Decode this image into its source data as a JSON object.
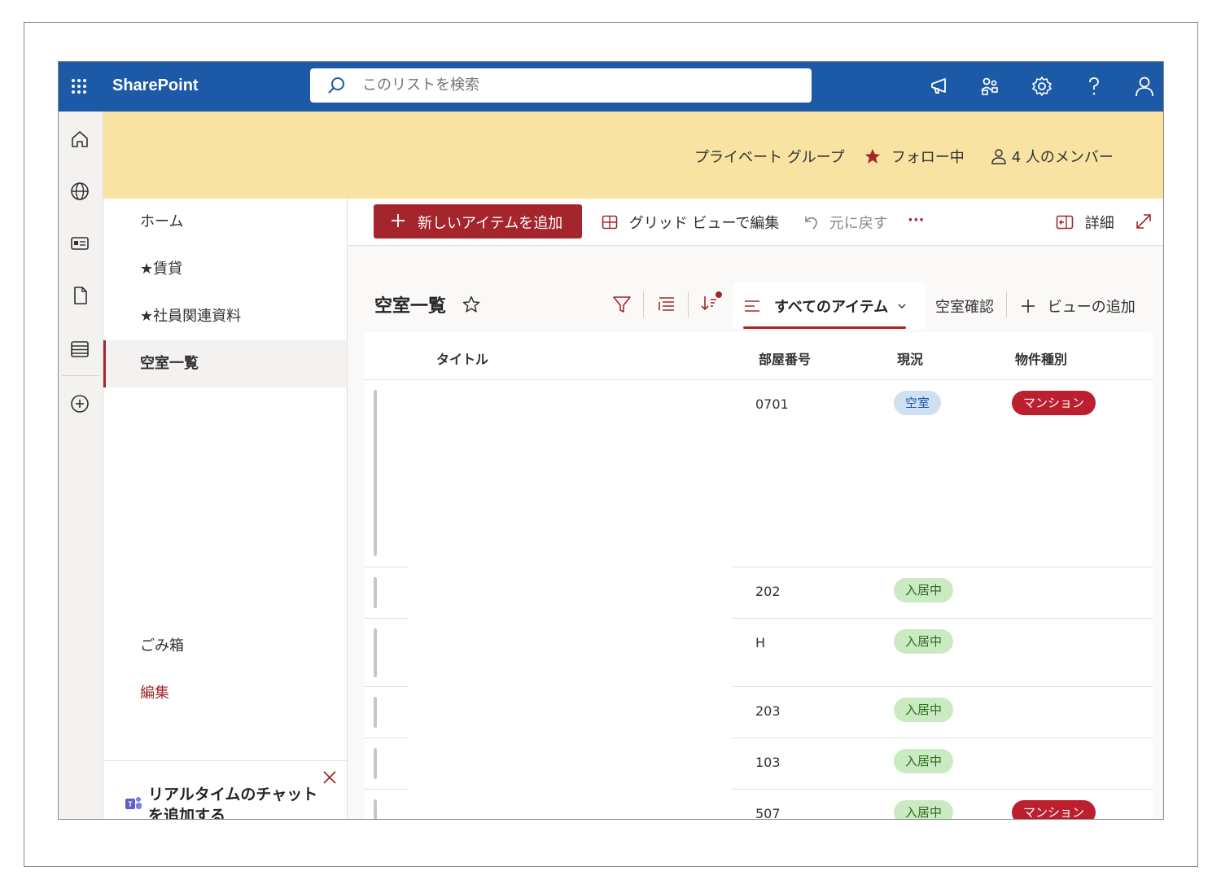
{
  "suite_bar": {
    "app_name": "SharePoint",
    "search_placeholder": "このリストを検索"
  },
  "site_header": {
    "privacy": "プライベート グループ",
    "follow": "フォロー中",
    "members": "4 人のメンバー"
  },
  "left_nav": {
    "items": [
      {
        "label": "ホーム",
        "selected": false
      },
      {
        "label": "★賃貸",
        "selected": false
      },
      {
        "label": "★社員関連資料",
        "selected": false
      },
      {
        "label": "空室一覧",
        "selected": true
      }
    ],
    "recycle_bin": "ごみ箱",
    "edit": "編集",
    "teams_promo": "リアルタイムのチャットを追加する"
  },
  "command_bar": {
    "new_item": "新しいアイテムを追加",
    "grid_edit": "グリッド ビューで編集",
    "undo": "元に戻す",
    "more": "···",
    "details": "詳細"
  },
  "list": {
    "title": "空室一覧",
    "current_view": "すべてのアイテム",
    "other_view": "空室確認",
    "add_view": "ビューの追加",
    "columns": [
      "タイトル",
      "部屋番号",
      "現況",
      "物件種別"
    ],
    "rows": [
      {
        "title": "",
        "room": "0701",
        "status": "空室",
        "type": "マンション"
      },
      {
        "title": "",
        "room": "202",
        "status": "入居中",
        "type": ""
      },
      {
        "title": "",
        "room": "H",
        "status": "入居中",
        "type": ""
      },
      {
        "title": "",
        "room": "203",
        "status": "入居中",
        "type": ""
      },
      {
        "title": "",
        "room": "103",
        "status": "入居中",
        "type": ""
      },
      {
        "title": "",
        "room": "507",
        "status": "入居中",
        "type": "マンション"
      }
    ]
  },
  "colors": {
    "suite_bar": "#1c5aa8",
    "header_band": "#f9e3a3",
    "accent": "#a4262c",
    "pill_vacant": "#cfe0f1",
    "pill_occupied": "#caeac2",
    "pill_type": "#bc1f2e"
  }
}
